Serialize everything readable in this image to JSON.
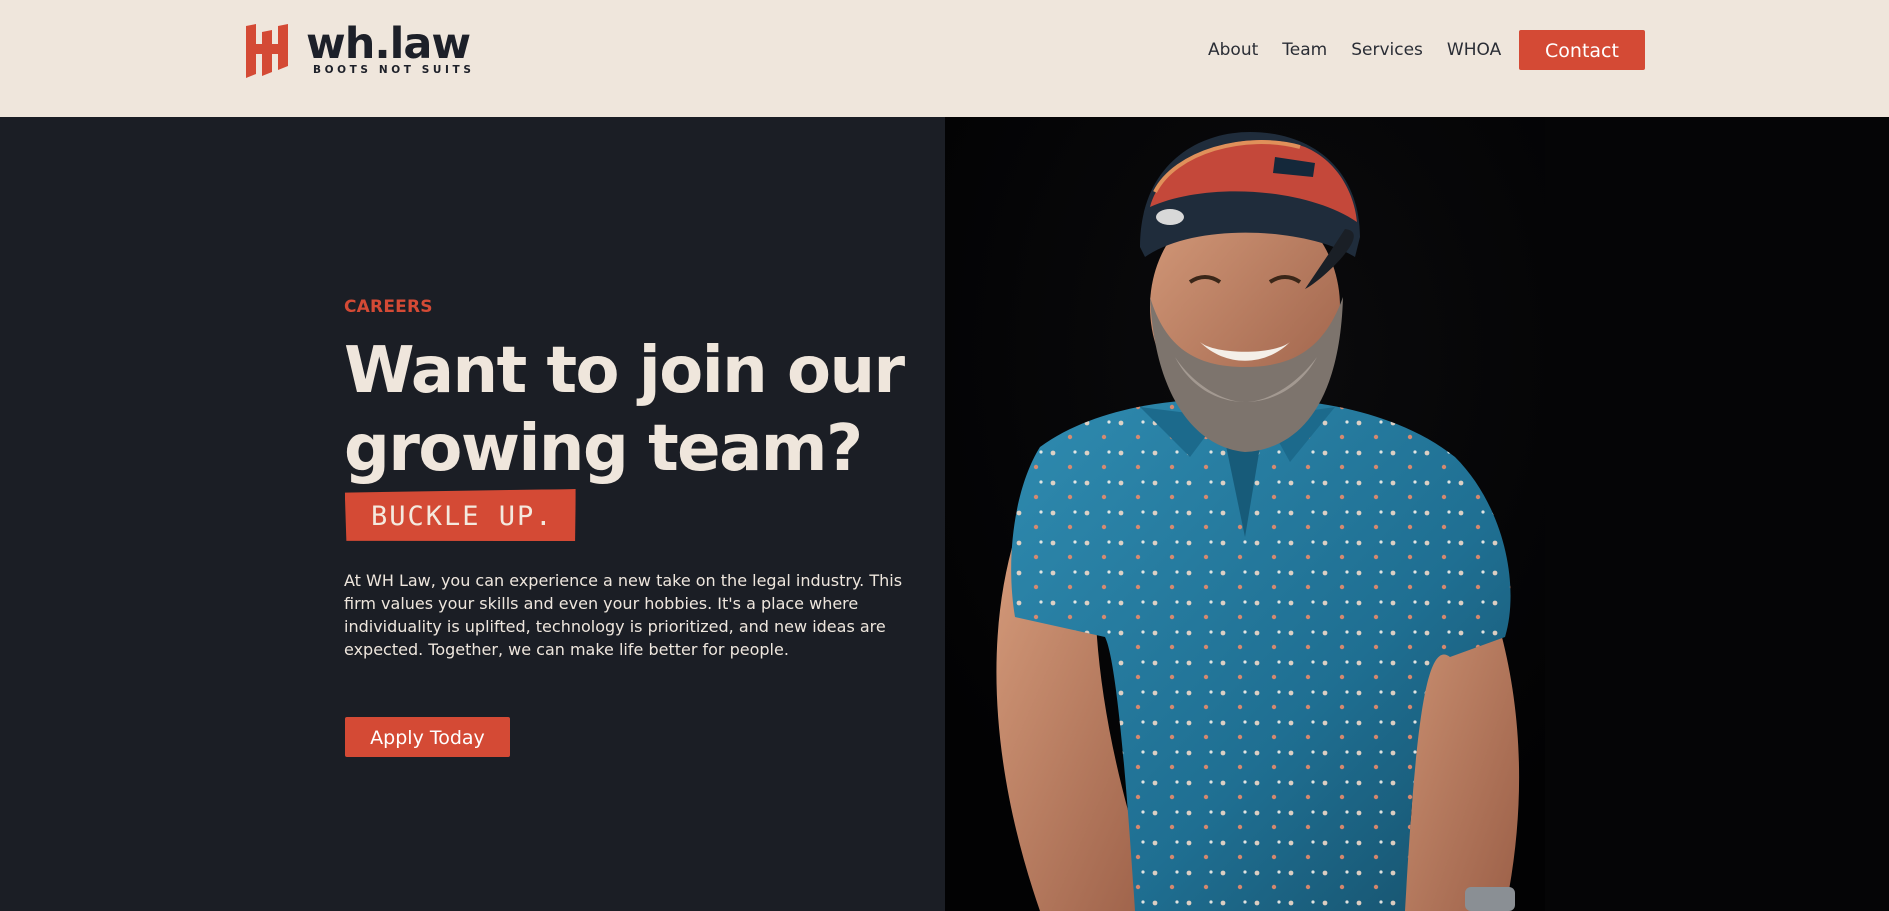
{
  "header": {
    "logo": {
      "wordmark": "wh.law",
      "tagline": "BOOTS NOT SUITS"
    },
    "nav": [
      {
        "label": "About"
      },
      {
        "label": "Team"
      },
      {
        "label": "Services"
      },
      {
        "label": "WHOA"
      }
    ],
    "contact_label": "Contact"
  },
  "hero": {
    "eyebrow": "CAREERS",
    "headline_line1": "Want to join our",
    "headline_line2": "growing team?",
    "stamp": "BUCKLE UP.",
    "body": "At WH Law, you can experience a new take on the legal industry. This firm values your skills and even your hobbies. It's a place where individuality is uplifted, technology is prioritized, and new ideas are expected. Together, we can make life better for people.",
    "cta_label": "Apply Today"
  },
  "photo": {
    "subject": "bearded man in red-and-navy trucker cap and blue patterned polo shirt"
  },
  "colors": {
    "accent": "#d44a35",
    "header_bg": "#efe6dc",
    "hero_bg": "#1b1e25",
    "photo_bg": "#050506",
    "text_light": "#efe6dc",
    "text_dark": "#1d2029"
  }
}
